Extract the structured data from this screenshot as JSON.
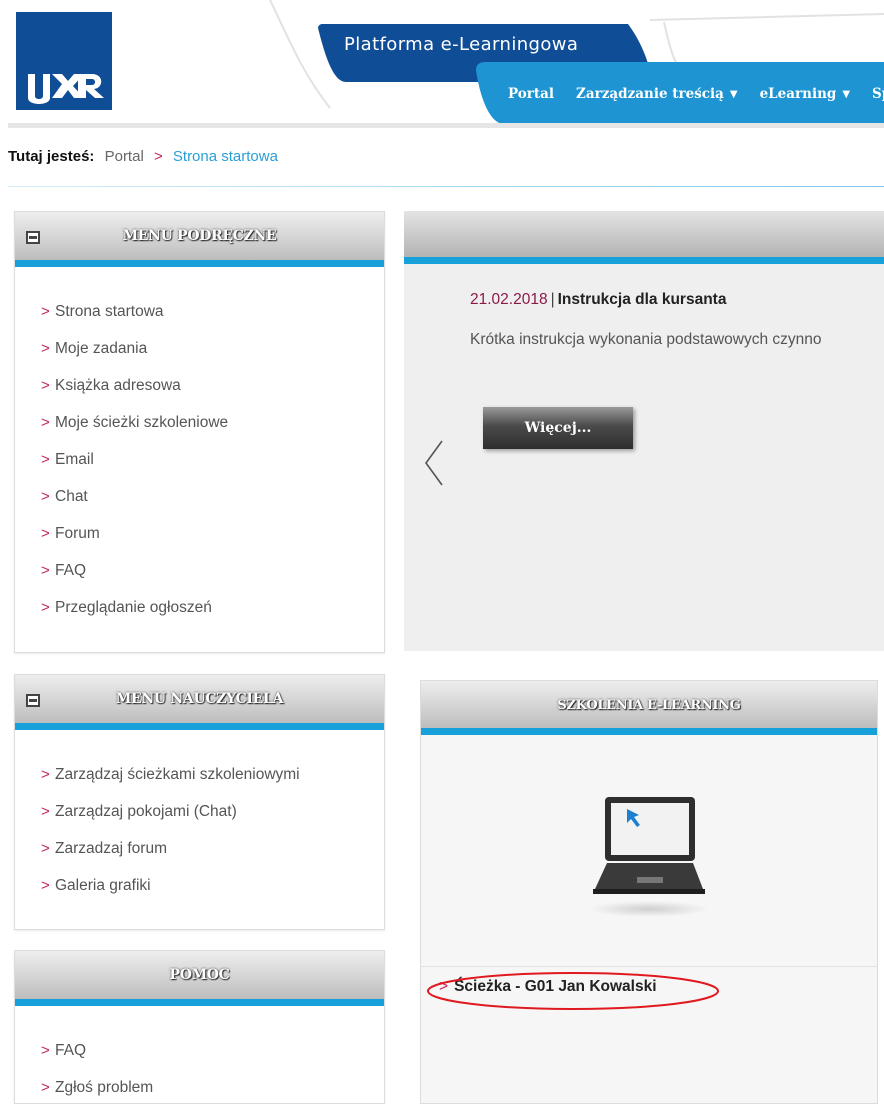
{
  "header": {
    "platform_title": "Platforma e-Learningowa",
    "nav": [
      {
        "label": "Portal",
        "has_caret": false
      },
      {
        "label": "Zarządzanie treścią",
        "has_caret": true
      },
      {
        "label": "eLearning",
        "has_caret": true
      },
      {
        "label": "Spo",
        "has_caret": false
      }
    ],
    "logo_icon": "ur-logo-icon",
    "brand_colors": {
      "dark_blue": "#0f4d96",
      "accent_blue": "#17a0da",
      "accent_red": "#c2255c"
    }
  },
  "breadcrumb": {
    "label": "Tutaj jesteś:",
    "items": [
      "Portal",
      "Strona startowa"
    ]
  },
  "quick_menu": {
    "title": "MENU PODRĘCZNE",
    "items": [
      "Strona startowa",
      "Moje zadania",
      "Książka adresowa",
      "Moje ścieżki szkoleniowe",
      "Email",
      "Chat",
      "Forum",
      "FAQ",
      "Przeglądanie ogłoszeń"
    ]
  },
  "teacher_menu": {
    "title": "MENU NAUCZYCIELA",
    "items": [
      "Zarządzaj ścieżkami szkoleniowymi",
      "Zarządzaj pokojami (Chat)",
      "Zarzadzaj forum",
      "Galeria grafiki"
    ]
  },
  "help_menu": {
    "title": "POMOC",
    "items": [
      "FAQ",
      "Zgłoś problem"
    ]
  },
  "news": {
    "date": "21.02.2018",
    "separator": "|",
    "title": "Instrukcja dla kursanta",
    "description": "Krótka instrukcja wykonania podstawowych czynno",
    "more_label": "Więcej...",
    "prev_icon": "chevron-left-icon"
  },
  "elearning": {
    "title": "SZKOLENIA E-LEARNING",
    "image_icon": "laptop-icon",
    "course_link": "Ścieżka - G01 Jan Kowalski"
  }
}
